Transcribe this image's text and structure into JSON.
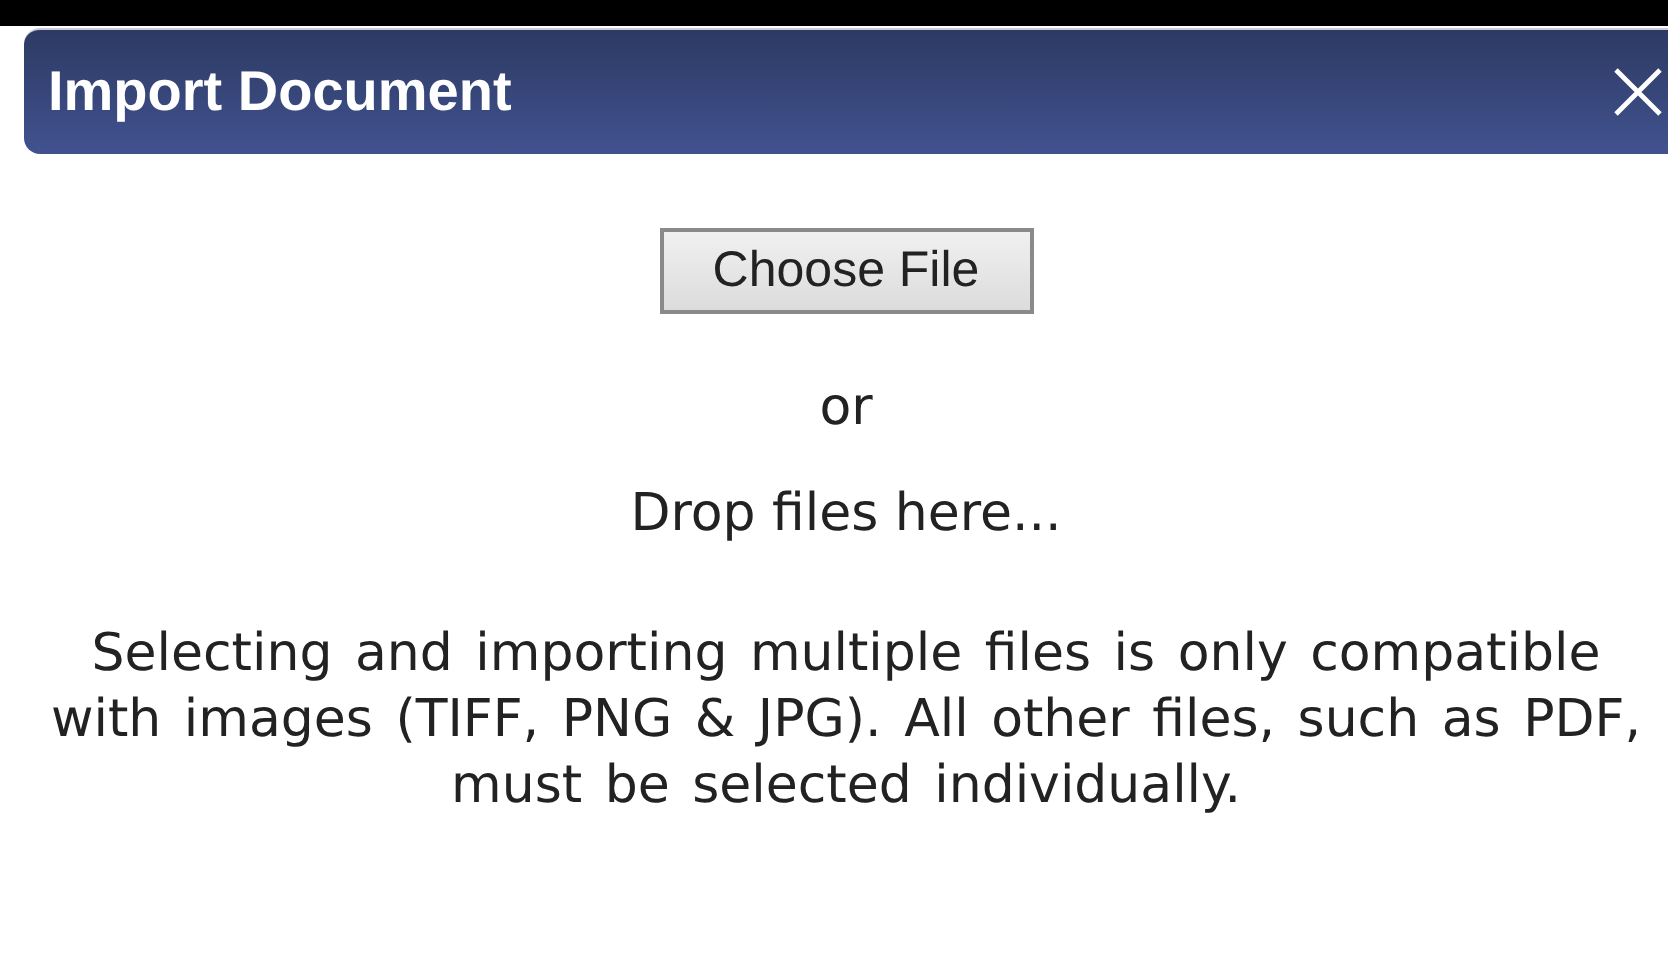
{
  "dialog": {
    "title": "Import Document"
  },
  "button": {
    "label": "Choose File"
  },
  "separator": "or",
  "drop_hint": "Drop files here...",
  "note": "Selecting and importing multiple files is only compatible with images (TIFF, PNG & JPG). All other files, such as PDF, must be selected individually."
}
